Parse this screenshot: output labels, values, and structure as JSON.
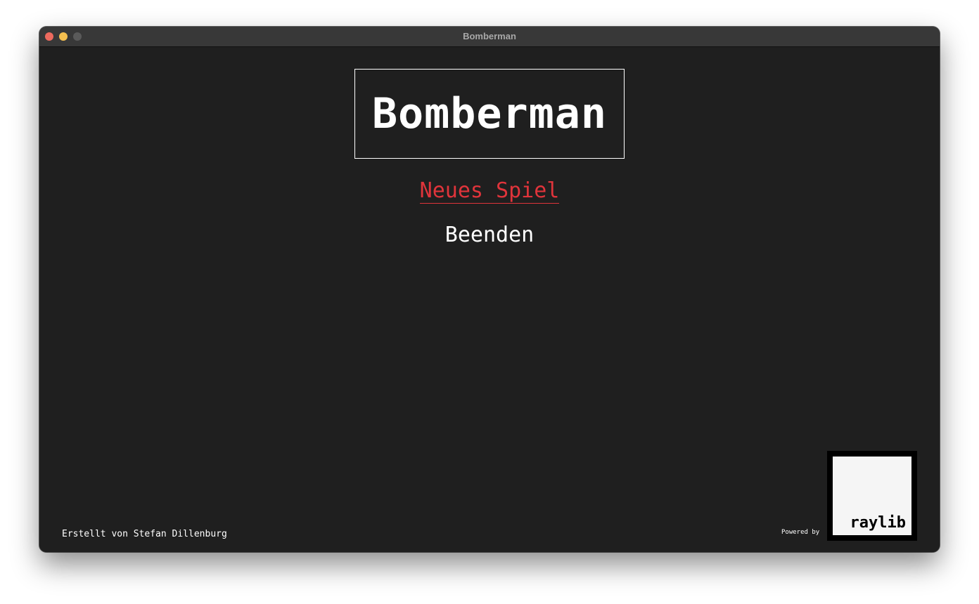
{
  "window": {
    "title": "Bomberman"
  },
  "game": {
    "title": "Bomberman"
  },
  "menu": {
    "items": [
      {
        "label": "Neues Spiel",
        "selected": true
      },
      {
        "label": "Beenden",
        "selected": false
      }
    ]
  },
  "footer": {
    "credit": "Erstellt von Stefan Dillenburg",
    "powered_by": "Powered by",
    "logo_text": "raylib"
  },
  "colors": {
    "background": "#1f1f1f",
    "selected": "#e0343b",
    "text": "#ffffff"
  }
}
